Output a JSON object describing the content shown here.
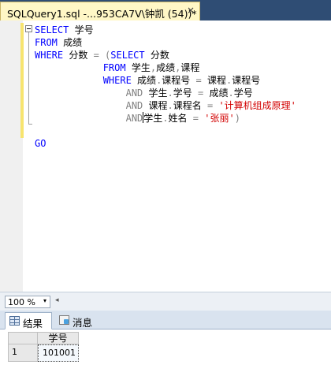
{
  "tab": {
    "title": "SQLQuery1.sql -...953CA7V\\钟凯 (54))*",
    "close": "×"
  },
  "editor": {
    "lines": [
      [
        {
          "t": "SELECT",
          "c": "kw"
        },
        {
          "t": " 学号",
          "c": "txt"
        }
      ],
      [
        {
          "t": "FROM",
          "c": "kw"
        },
        {
          "t": " 成绩",
          "c": "txt"
        }
      ],
      [
        {
          "t": "WHERE",
          "c": "kw"
        },
        {
          "t": " 分数 ",
          "c": "txt"
        },
        {
          "t": "= (",
          "c": "gray"
        },
        {
          "t": "SELECT",
          "c": "kw"
        },
        {
          "t": " 分数",
          "c": "txt"
        }
      ],
      [
        {
          "t": "            ",
          "c": "txt"
        },
        {
          "t": "FROM",
          "c": "kw"
        },
        {
          "t": " 学生",
          "c": "txt"
        },
        {
          "t": ",",
          "c": "gray"
        },
        {
          "t": "成绩",
          "c": "txt"
        },
        {
          "t": ",",
          "c": "gray"
        },
        {
          "t": "课程",
          "c": "txt"
        }
      ],
      [
        {
          "t": "            ",
          "c": "txt"
        },
        {
          "t": "WHERE",
          "c": "kw"
        },
        {
          "t": " 成绩",
          "c": "txt"
        },
        {
          "t": ".",
          "c": "gray"
        },
        {
          "t": "课程号 ",
          "c": "txt"
        },
        {
          "t": "=",
          "c": "gray"
        },
        {
          "t": " 课程",
          "c": "txt"
        },
        {
          "t": ".",
          "c": "gray"
        },
        {
          "t": "课程号",
          "c": "txt"
        }
      ],
      [
        {
          "t": "                ",
          "c": "txt"
        },
        {
          "t": "AND",
          "c": "gray"
        },
        {
          "t": " 学生",
          "c": "txt"
        },
        {
          "t": ".",
          "c": "gray"
        },
        {
          "t": "学号 ",
          "c": "txt"
        },
        {
          "t": "=",
          "c": "gray"
        },
        {
          "t": " 成绩",
          "c": "txt"
        },
        {
          "t": ".",
          "c": "gray"
        },
        {
          "t": "学号",
          "c": "txt"
        }
      ],
      [
        {
          "t": "                ",
          "c": "txt"
        },
        {
          "t": "AND",
          "c": "gray"
        },
        {
          "t": " 课程",
          "c": "txt"
        },
        {
          "t": ".",
          "c": "gray"
        },
        {
          "t": "课程名 ",
          "c": "txt"
        },
        {
          "t": "=",
          "c": "gray"
        },
        {
          "t": " '计算机组成原理'",
          "c": "str"
        }
      ],
      [
        {
          "t": "                ",
          "c": "txt"
        },
        {
          "t": "AND",
          "c": "gray"
        },
        {
          "t": "|",
          "c": "caret"
        },
        {
          "t": "学生",
          "c": "txt"
        },
        {
          "t": ".",
          "c": "gray"
        },
        {
          "t": "姓名 ",
          "c": "txt"
        },
        {
          "t": "=",
          "c": "gray"
        },
        {
          "t": " '张丽'",
          "c": "str"
        },
        {
          "t": ")",
          "c": "gray"
        }
      ],
      [
        {
          "t": "",
          "c": "txt"
        }
      ],
      [
        {
          "t": "GO",
          "c": "kw"
        }
      ]
    ]
  },
  "zoom": {
    "value": "100 %",
    "arrow": "▾",
    "scroll_left": "◂"
  },
  "results_tabs": {
    "results": "结果",
    "messages": "消息"
  },
  "grid": {
    "column": "学号",
    "row_number": "1",
    "value": "101001"
  }
}
